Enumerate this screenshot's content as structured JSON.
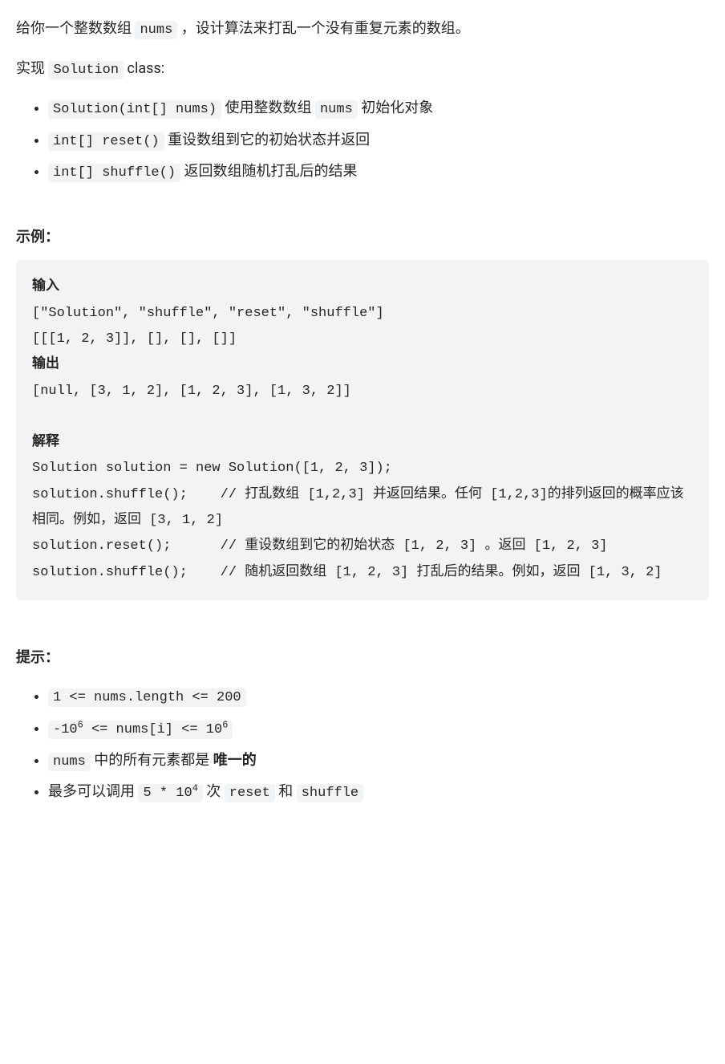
{
  "intro": {
    "line1_prefix": "给你一个整数数组 ",
    "line1_code": "nums",
    "line1_suffix": " ，设计算法来打乱一个没有重复元素的数组。",
    "line2_prefix": "实现 ",
    "line2_code": "Solution",
    "line2_suffix": " class:"
  },
  "methods": [
    {
      "code": "Solution(int[] nums)",
      "text_prefix": " 使用整数数组 ",
      "inner_code": "nums",
      "text_suffix": " 初始化对象"
    },
    {
      "code": "int[] reset()",
      "text_prefix": " 重设数组到它的初始状态并返回",
      "inner_code": "",
      "text_suffix": ""
    },
    {
      "code": "int[] shuffle()",
      "text_prefix": " 返回数组随机打乱后的结果",
      "inner_code": "",
      "text_suffix": ""
    }
  ],
  "example_label": "示例：",
  "example": {
    "input_label": "输入",
    "input_line1": "[\"Solution\", \"shuffle\", \"reset\", \"shuffle\"]",
    "input_line2": "[[[1, 2, 3]], [], [], []]",
    "output_label": "输出",
    "output_line": "[null, [3, 1, 2], [1, 2, 3], [1, 3, 2]]",
    "explain_label": "解释",
    "explain_line1": "Solution solution = new Solution([1, 2, 3]);",
    "explain_line2": "solution.shuffle();    // 打乱数组 [1,2,3] 并返回结果。任何 [1,2,3]的排列返回的概率应该相同。例如，返回 [3, 1, 2]",
    "explain_line3": "solution.reset();      // 重设数组到它的初始状态 [1, 2, 3] 。返回 [1, 2, 3]",
    "explain_line4": "solution.shuffle();    // 随机返回数组 [1, 2, 3] 打乱后的结果。例如，返回 [1, 3, 2]"
  },
  "hints_label": "提示：",
  "hints": {
    "h1_code": "1 <= nums.length <= 200",
    "h2_prefix": "-10",
    "h2_sup1": "6",
    "h2_mid": " <= nums[i] <= 10",
    "h2_sup2": "6",
    "h3_code": "nums",
    "h3_text": " 中的所有元素都是 ",
    "h3_bold": "唯一的",
    "h4_text1": "最多可以调用 ",
    "h4_code1_prefix": "5 * 10",
    "h4_code1_sup": "4",
    "h4_text2": " 次 ",
    "h4_code2": "reset",
    "h4_text3": " 和 ",
    "h4_code3": "shuffle"
  }
}
